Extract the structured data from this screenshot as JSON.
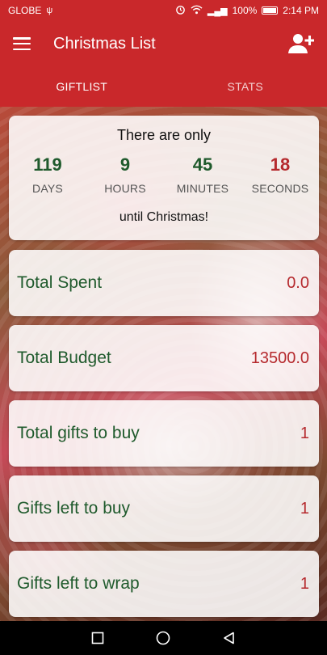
{
  "status_bar": {
    "carrier": "GLOBE",
    "usb_glyph": "ψ",
    "signal_glyph": "▂▄▆",
    "battery_pct": "100%",
    "time": "2:14 PM"
  },
  "app_bar": {
    "title": "Christmas List",
    "menu_icon": "hamburger-icon",
    "action_icon": "add-user-icon"
  },
  "tabs": [
    {
      "label": "GIFTLIST",
      "active": true
    },
    {
      "label": "STATS",
      "active": false
    }
  ],
  "countdown": {
    "heading": "There are only",
    "units": [
      {
        "value": "119",
        "label": "DAYS"
      },
      {
        "value": "9",
        "label": "HOURS"
      },
      {
        "value": "45",
        "label": "MINUTES"
      },
      {
        "value": "18",
        "label": "SECONDS"
      }
    ],
    "footer": "until Christmas!"
  },
  "stats": [
    {
      "label": "Total Spent",
      "value": "0.0"
    },
    {
      "label": "Total Budget",
      "value": "13500.0"
    },
    {
      "label": "Total gifts to buy",
      "value": "1"
    },
    {
      "label": "Gifts left to buy",
      "value": "1"
    },
    {
      "label": "Gifts left to wrap",
      "value": "1"
    }
  ],
  "colors": {
    "primary": "#c9282b",
    "green": "#1f5a2c",
    "red": "#b5292d"
  },
  "nav": {
    "back": "back-icon",
    "home": "home-icon",
    "recents": "recents-icon"
  }
}
